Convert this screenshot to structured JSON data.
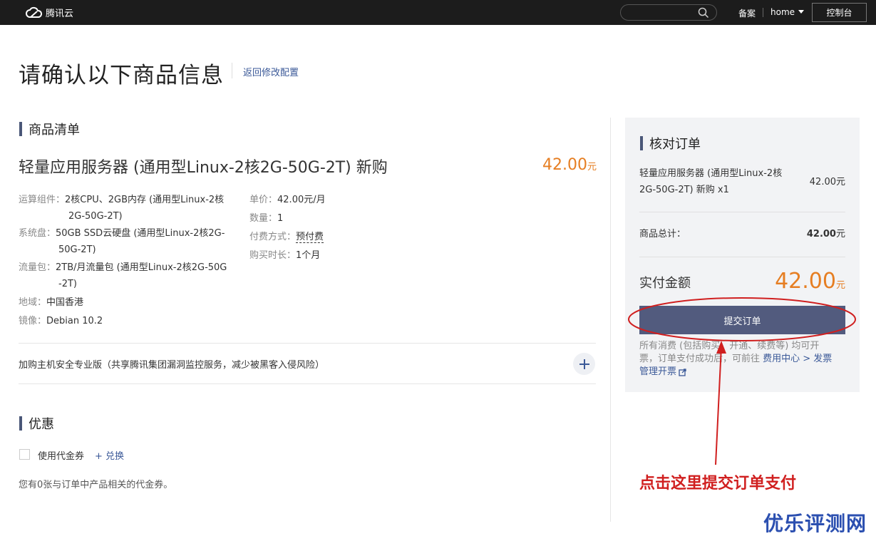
{
  "topbar": {
    "logo_text": "腾讯云",
    "search_placeholder": "",
    "beian": "备案",
    "home": "home",
    "console": "控制台"
  },
  "page": {
    "title": "请确认以下商品信息",
    "back_link": "返回修改配置"
  },
  "goods": {
    "section_title": "商品清单",
    "product_title": "轻量应用服务器 (通用型Linux-2核2G-50G-2T) 新购",
    "price": "42.00",
    "currency": "元",
    "specs_left": [
      {
        "label": "运算组件：",
        "value_line1": "2核CPU、2GB内存 (通用型Linux-2核",
        "value_line2": "2G-50G-2T)"
      },
      {
        "label": "系统盘：",
        "value_line1": "50GB SSD云硬盘 (通用型Linux-2核2G-",
        "value_line2": "50G-2T)"
      },
      {
        "label": "流量包：",
        "value_line1": "2TB/月流量包 (通用型Linux-2核2G-50G",
        "value_line2": "-2T)"
      },
      {
        "label": "地域：",
        "value_line1": "中国香港"
      },
      {
        "label": "镜像：",
        "value_line1": "Debian 10.2"
      }
    ],
    "specs_right": [
      {
        "label": "单价：",
        "value": "42.00元/月"
      },
      {
        "label": "数量：",
        "value": "1"
      },
      {
        "label": "付费方式：",
        "value": "预付费"
      },
      {
        "label": "购买时长：",
        "value": "1个月"
      }
    ],
    "addon": "加购主机安全专业版（共享腾讯集团漏洞监控服务，减少被黑客入侵风险）"
  },
  "discount": {
    "section_title": "优惠",
    "use_coupon": "使用代金券",
    "exchange": "+ 兑换",
    "note": "您有0张与订单中产品相关的代金券。"
  },
  "order": {
    "title": "核对订单",
    "item_line1": "轻量应用服务器 (通用型Linux-2核",
    "item_line2": "2G-50G-2T) 新购 x1",
    "item_price": "42.00元",
    "total_label": "商品总计：",
    "total_value": "42.00",
    "total_unit": "元",
    "pay_label": "实付金额",
    "pay_value": "42.00",
    "pay_unit": "元",
    "submit": "提交订单",
    "note_line1": "所有消费 (包括购买、开通、续费等) 均可开",
    "note_line2_a": "票，订单支付成功后，可前往 ",
    "note_link1": "费用中心 > 发票",
    "note_link2": "管理开票"
  },
  "annotation": {
    "text": "点击这里提交订单支付",
    "watermark": "优乐评测网",
    "color": "#d01f1f"
  }
}
